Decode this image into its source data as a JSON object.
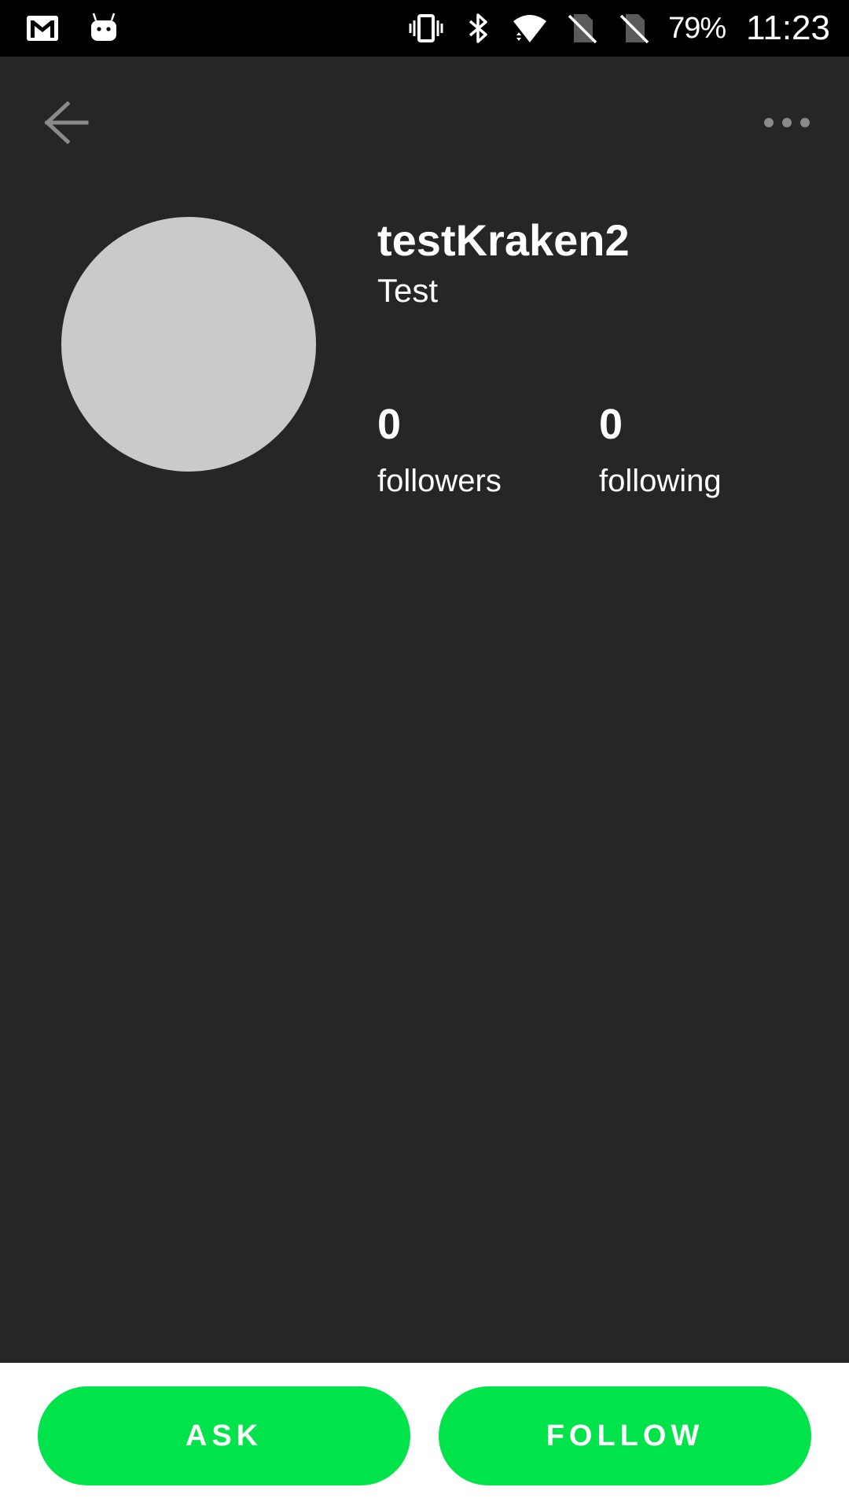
{
  "status_bar": {
    "left_icons": [
      "gmail-icon",
      "android-debug-icon"
    ],
    "right_icons": [
      "vibrate-icon",
      "bluetooth-icon",
      "wifi-icon",
      "no-sim-icon",
      "no-sim-icon"
    ],
    "battery_percent": "79%",
    "time": "11:23"
  },
  "toolbar": {
    "back_icon": "arrow-left-icon",
    "more_icon": "more-horizontal-icon"
  },
  "profile": {
    "username": "testKraken2",
    "bio": "Test",
    "followers_count": "0",
    "followers_label": "followers",
    "following_count": "0",
    "following_label": "following"
  },
  "actions": {
    "ask_label": "ASK",
    "follow_label": "FOLLOW"
  },
  "colors": {
    "background": "#262626",
    "status_bar": "#000000",
    "avatar_placeholder": "#cacaca",
    "accent_green": "#00e34a",
    "bottom_bar": "#ffffff"
  }
}
